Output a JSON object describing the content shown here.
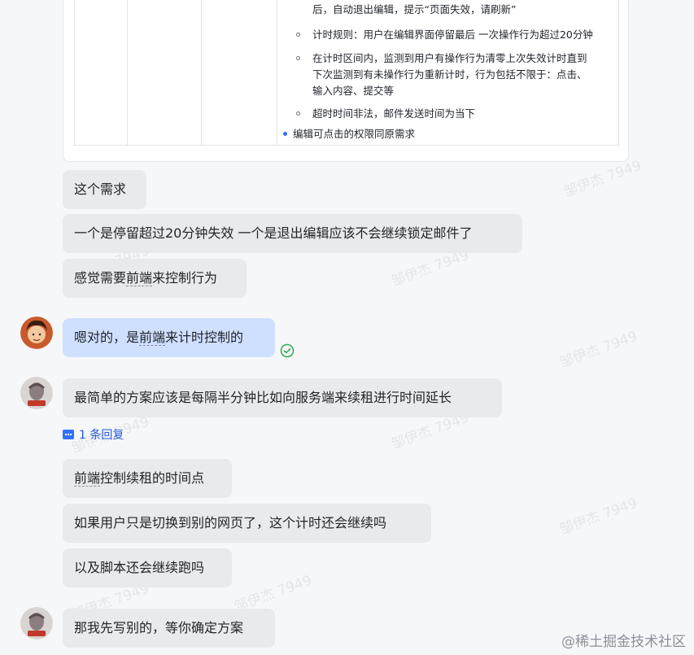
{
  "doc_card": {
    "lines": [
      "后，自动退出编辑，提示“页面失效，请刷新”",
      "计时规则：用户在编辑界面停留最后 一次操作行为超过20分钟",
      "在计时区间内，监测到用户有操作行为清零上次失效计时直到",
      "下次监测到有未操作行为重新计时，行为包括不限于：点击、",
      "输入内容、提交等",
      "超时时间非法，邮件发送时间为当下",
      "编辑可点击的权限同原需求"
    ]
  },
  "messages": [
    {
      "text": "这个需求"
    },
    {
      "text": "一个是停留超过20分钟失效 一个是退出编辑应该不会继续锁定邮件了"
    },
    {
      "text_pre": "感觉需要",
      "text_dotted": "前端",
      "text_post": "来控制行为"
    },
    {
      "text_pre": "嗯对的，是",
      "text_dotted": "前端",
      "text_post": "来计时控制的"
    },
    {
      "text": "最简单的方案应该是每隔半分钟比如向服务端来续租进行时间延长"
    },
    {
      "text_dotted": "前端",
      "text_post": "控制续租的时间点"
    },
    {
      "text": "如果用户只是切换到别的网页了，这个计时还会继续吗"
    },
    {
      "text": "以及脚本还会继续跑吗"
    },
    {
      "text": "那我先写别的，等你确定方案"
    }
  ],
  "reply_link": "1 条回复",
  "watermark": "邹伊杰 7949",
  "footer_brand": "@稀土掘金技术社区",
  "colors": {
    "self_bubble": "#cfe0ff",
    "other_bubble": "#e9eaed",
    "link": "#245bdb"
  }
}
